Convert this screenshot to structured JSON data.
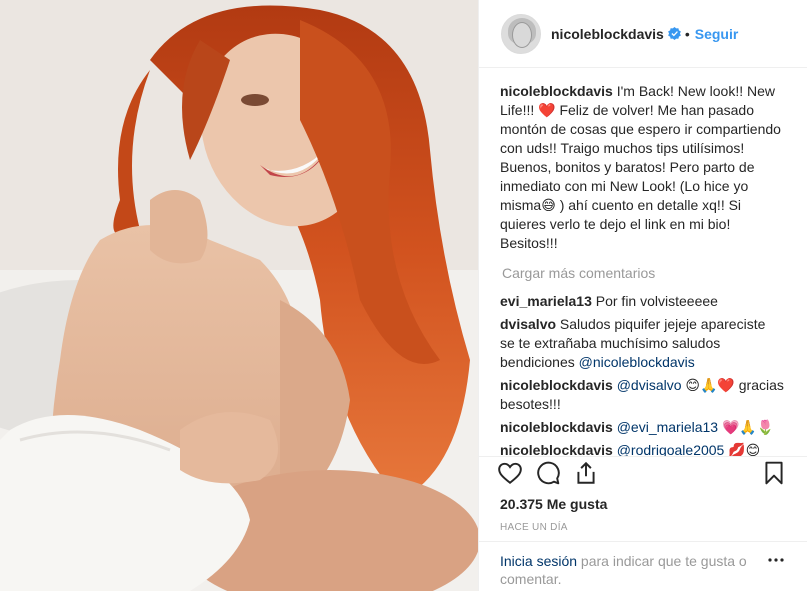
{
  "header": {
    "username": "nicoleblockdavis",
    "separator": "•",
    "follow_label": "Seguir",
    "verified_icon": "verified-badge-icon"
  },
  "caption": {
    "username": "nicoleblockdavis",
    "text": "I'm Back! New look!! New Life!!! ❤️ Feliz de volver! Me han pasado montón de cosas que espero ir compartiendo con uds!! Traigo muchos tips utilísimos! Buenos, bonitos y baratos! Pero parto de inmediato con mi New Look! (Lo hice yo misma😅 ) ahí cuento en detalle xq!! Si quieres verlo te dejo el link en mi bio! Besitos!!!"
  },
  "load_more": "Cargar más comentarios",
  "comments": [
    {
      "user": "evi_mariela13",
      "text": "Por fin volvisteeeee",
      "mention": "",
      "tail": ""
    },
    {
      "user": "dvisalvo",
      "text": "Saludos piquifer jejeje apareciste se te extrañaba muchísimo saludos bendiciones ",
      "mention": "@nicoleblockdavis",
      "tail": ""
    },
    {
      "user": "nicoleblockdavis",
      "text": "",
      "mention": "@dvisalvo",
      "tail": " 😊🙏❤️ gracias besotes!!!"
    },
    {
      "user": "nicoleblockdavis",
      "text": "",
      "mention": "@evi_mariela13",
      "tail": " 💗🙏🌷"
    },
    {
      "user": "nicoleblockdavis",
      "text": "",
      "mention": "@rodrigoale2005",
      "tail": " 💋😊"
    }
  ],
  "likes": "20.375 Me gusta",
  "timestamp": "HACE UN DÍA",
  "login": {
    "link": "Inicia sesión",
    "text": " para indicar que te gusta o comentar."
  },
  "colors": {
    "accent": "#3897f0",
    "mention": "#003569",
    "muted": "#999999",
    "border": "#efefef"
  }
}
